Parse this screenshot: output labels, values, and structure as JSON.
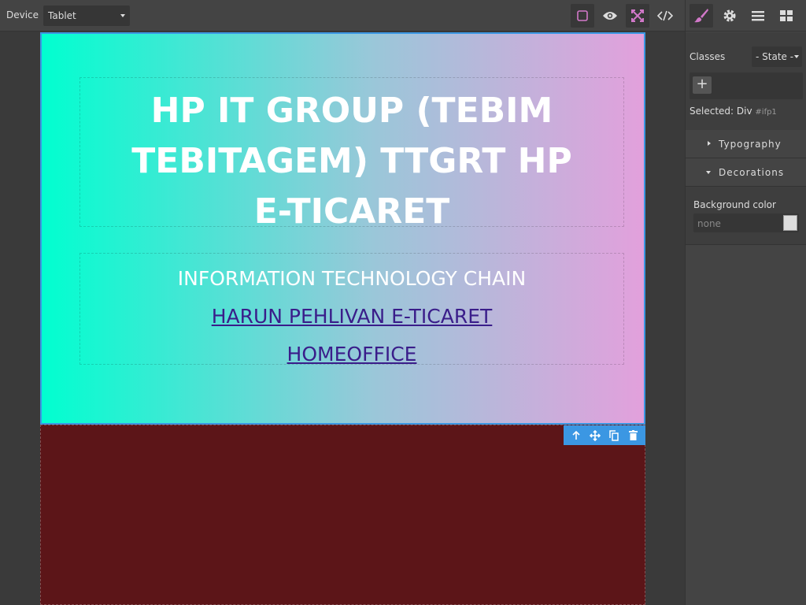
{
  "topbar": {
    "device_label": "Device",
    "device_value": "Tablet"
  },
  "colors": {
    "accent": "#d278c9",
    "selection": "#3b97e3",
    "hero_gradient_start": "#00ffd0",
    "hero_gradient_end": "#e3a0dc",
    "lower_section": "#5c1518",
    "link": "#3a1d8a"
  },
  "canvas": {
    "hero_title": "HP IT GROUP (TEBIM TEBITAGEM) TTGRT HP E-TICARET",
    "hero_sub": "INFORMATION TECHNOLOGY CHAIN",
    "hero_links": [
      "HARUN PEHLIVAN E-TICARET",
      "HOMEOFFICE"
    ]
  },
  "panel": {
    "classes_label": "Classes",
    "state_value": "- State -",
    "add_symbol": "+",
    "selected_label": "Selected:",
    "selected_value": "Div",
    "selected_id": "#ifp1",
    "sectors": [
      "Typography",
      "Decorations"
    ],
    "background_color_label": "Background color",
    "background_color_placeholder": "none"
  }
}
